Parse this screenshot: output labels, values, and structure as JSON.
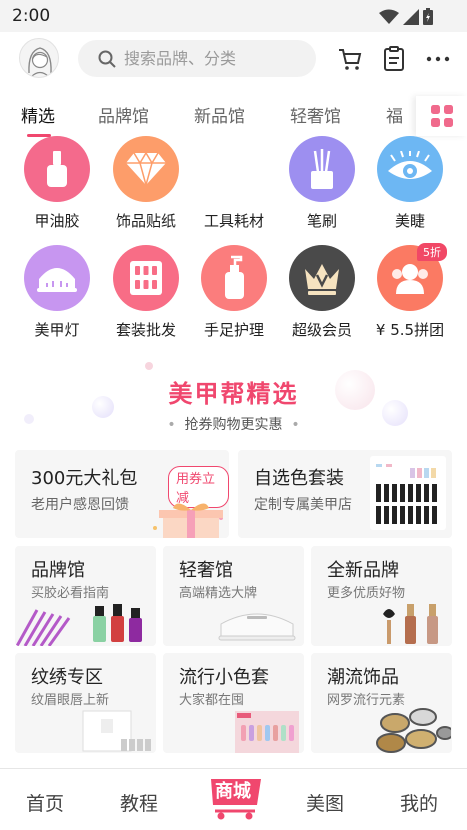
{
  "status": {
    "time": "2:00"
  },
  "search": {
    "placeholder": "搜索品牌、分类"
  },
  "tabs": [
    {
      "label": "精选",
      "active": true
    },
    {
      "label": "品牌馆"
    },
    {
      "label": "新品馆"
    },
    {
      "label": "轻奢馆"
    },
    {
      "label": "福"
    }
  ],
  "categories": [
    {
      "label": "甲油胶",
      "icon": "nail-polish-icon",
      "color": "#f46a8c"
    },
    {
      "label": "饰品贴纸",
      "icon": "diamond-icon",
      "color": "#fd9d6a"
    },
    {
      "label": "工具耗材",
      "icon": "tools-icon",
      "color": "#ffffff"
    },
    {
      "label": "笔刷",
      "icon": "brush-icon",
      "color": "#9d8ff0"
    },
    {
      "label": "美睫",
      "icon": "eye-icon",
      "color": "#6db7f3"
    },
    {
      "label": "美甲灯",
      "icon": "nail-lamp-icon",
      "color": "#c796f0"
    },
    {
      "label": "套装批发",
      "icon": "set-icon",
      "color": "#f86d86"
    },
    {
      "label": "手足护理",
      "icon": "lotion-icon",
      "color": "#fb7d7d"
    },
    {
      "label": "超级会员",
      "icon": "crown-icon",
      "color": "#4a4a4a"
    },
    {
      "label": "¥ 5.5拼团",
      "icon": "group-icon",
      "color": "#fb7a63",
      "badge": "5折"
    }
  ],
  "promo": {
    "title": "美甲帮精选",
    "subtitle": "抢券购物更实惠"
  },
  "cards": [
    {
      "title": "300元大礼包",
      "subtitle": "老用户感恩回馈",
      "badge": "用券立减"
    },
    {
      "title": "自选色套装",
      "subtitle": "定制专属美甲店"
    }
  ],
  "tiles": [
    {
      "title": "品牌馆",
      "subtitle": "买胶必看指南"
    },
    {
      "title": "轻奢馆",
      "subtitle": "高端精选大牌"
    },
    {
      "title": "全新品牌",
      "subtitle": "更多优质好物"
    },
    {
      "title": "纹绣专区",
      "subtitle": "纹眉眼唇上新"
    },
    {
      "title": "流行小色套",
      "subtitle": "大家都在囤"
    },
    {
      "title": "潮流饰品",
      "subtitle": "网罗流行元素"
    }
  ],
  "bottom_nav": [
    {
      "label": "首页"
    },
    {
      "label": "教程"
    },
    {
      "label": "商城",
      "active": true
    },
    {
      "label": "美图"
    },
    {
      "label": "我的"
    }
  ],
  "colors": {
    "accent": "#f0476e",
    "card_bg": "#f6f6f6"
  }
}
